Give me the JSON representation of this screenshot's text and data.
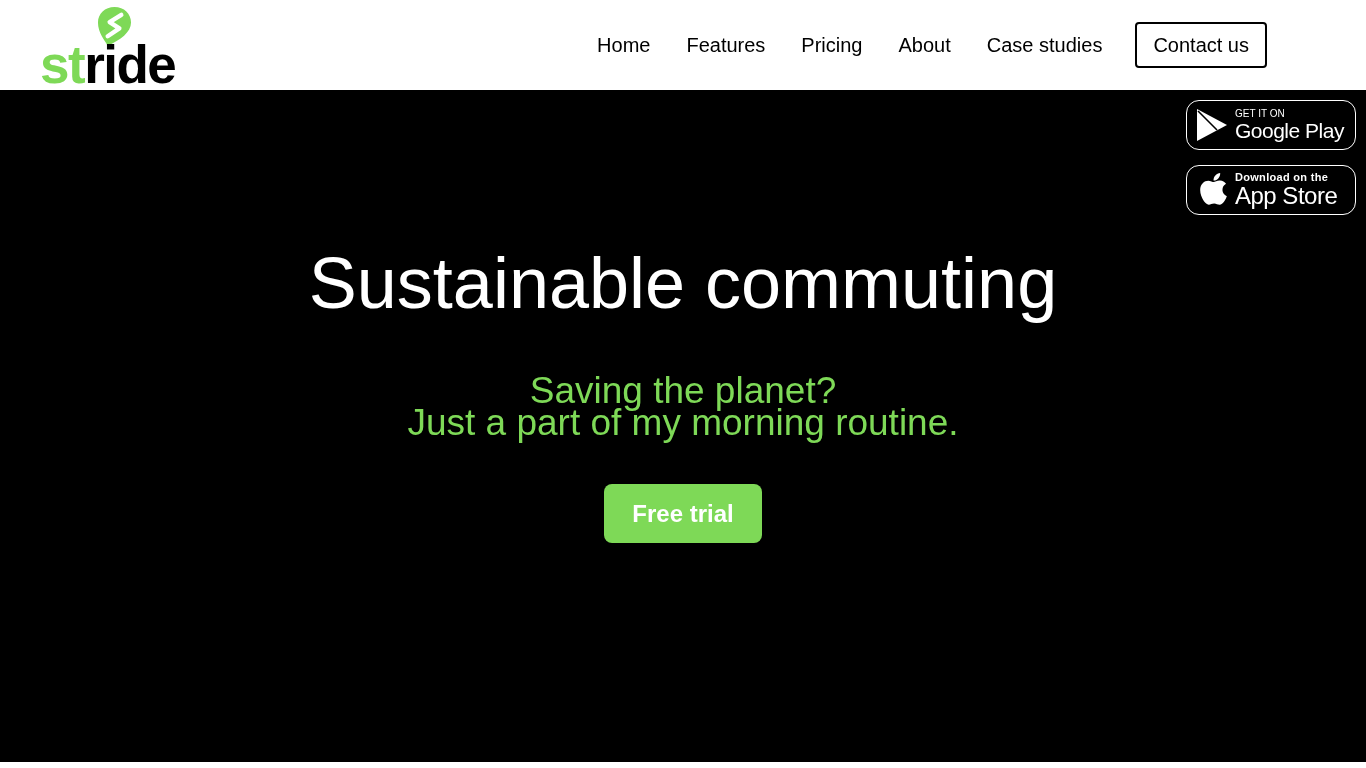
{
  "logo": {
    "accent": "st",
    "rest": "ride"
  },
  "nav": {
    "links": [
      "Home",
      "Features",
      "Pricing",
      "About",
      "Case studies"
    ],
    "contact_button": "Contact us"
  },
  "store_badges": [
    {
      "kind": "google_play",
      "caption": "GET IT ON",
      "store": "Google Play"
    },
    {
      "kind": "app_store",
      "caption": "Download on the",
      "store": "App Store"
    }
  ],
  "hero": {
    "title": "Sustainable commuting",
    "subtitle_lines": [
      "Saving the planet?",
      "Just a part of my morning routine."
    ],
    "cta": "Free trial"
  }
}
